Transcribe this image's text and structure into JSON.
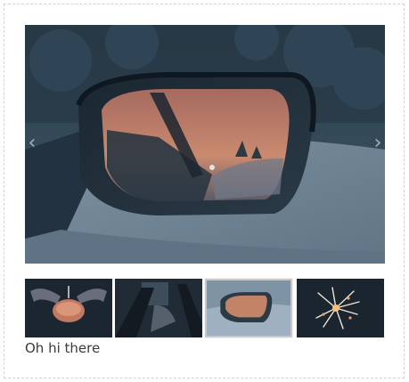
{
  "gallery": {
    "caption": "Oh hi there",
    "prev_icon": "chevron-left-icon",
    "next_icon": "chevron-right-icon",
    "nav": {
      "prev_glyph": "‹",
      "next_glyph": "›"
    },
    "thumbnails": [
      {
        "name": "thumbnail-hands-dish",
        "active": false
      },
      {
        "name": "thumbnail-car-interior",
        "active": false
      },
      {
        "name": "thumbnail-side-mirror",
        "active": true
      },
      {
        "name": "thumbnail-sparkler",
        "active": false
      }
    ]
  }
}
